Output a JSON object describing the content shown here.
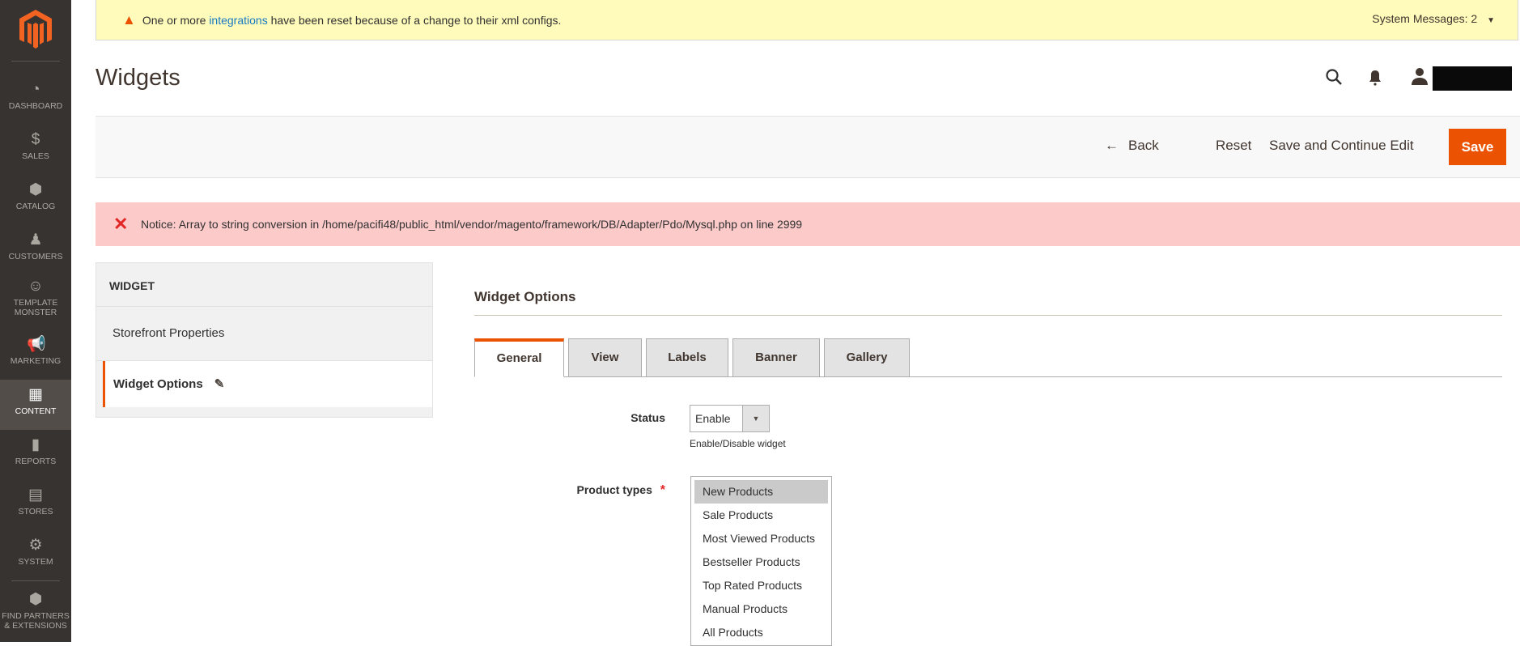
{
  "sidebar": {
    "items": [
      {
        "label": "DASHBOARD",
        "icon": "dashboard-icon"
      },
      {
        "label": "SALES",
        "icon": "dollar-icon"
      },
      {
        "label": "CATALOG",
        "icon": "box-icon"
      },
      {
        "label": "CUSTOMERS",
        "icon": "person-icon"
      },
      {
        "label": "TEMPLATE MONSTER",
        "icon": "monster-icon"
      },
      {
        "label": "MARKETING",
        "icon": "megaphone-icon"
      },
      {
        "label": "CONTENT",
        "icon": "layout-icon",
        "active": true
      },
      {
        "label": "REPORTS",
        "icon": "bar-chart-icon"
      },
      {
        "label": "STORES",
        "icon": "store-icon"
      },
      {
        "label": "SYSTEM",
        "icon": "gear-icon"
      },
      {
        "label": "FIND PARTNERS & EXTENSIONS",
        "icon": "blocks-icon"
      }
    ]
  },
  "system_message": {
    "prefix": "One or more ",
    "link": "integrations",
    "suffix": " have been reset because of a change to their xml configs.",
    "count_label": "System Messages: 2"
  },
  "header": {
    "title": "Widgets"
  },
  "toolbar": {
    "back": "Back",
    "reset": "Reset",
    "save_continue": "Save and Continue Edit",
    "save": "Save"
  },
  "notice": "Notice: Array to string conversion in /home/pacifi48/public_html/vendor/magento/framework/DB/Adapter/Pdo/Mysql.php on line 2999",
  "left_panel": {
    "heading": "WIDGET",
    "items": [
      "Storefront Properties",
      "Widget Options"
    ]
  },
  "section": {
    "title": "Widget Options",
    "tabs": [
      "General",
      "View",
      "Labels",
      "Banner",
      "Gallery"
    ],
    "active_tab": "General"
  },
  "form": {
    "status": {
      "label": "Status",
      "value": "Enable",
      "hint": "Enable/Disable widget"
    },
    "product_types": {
      "label": "Product types",
      "required": "*",
      "options": [
        "New Products",
        "Sale Products",
        "Most Viewed Products",
        "Bestseller Products",
        "Top Rated Products",
        "Manual Products",
        "All Products"
      ],
      "selected": "New Products"
    }
  },
  "colors": {
    "accent": "#eb5202",
    "sidebar": "#373330",
    "notice_bg": "#fdcaca",
    "sysmsg_bg": "#fffbbb"
  }
}
